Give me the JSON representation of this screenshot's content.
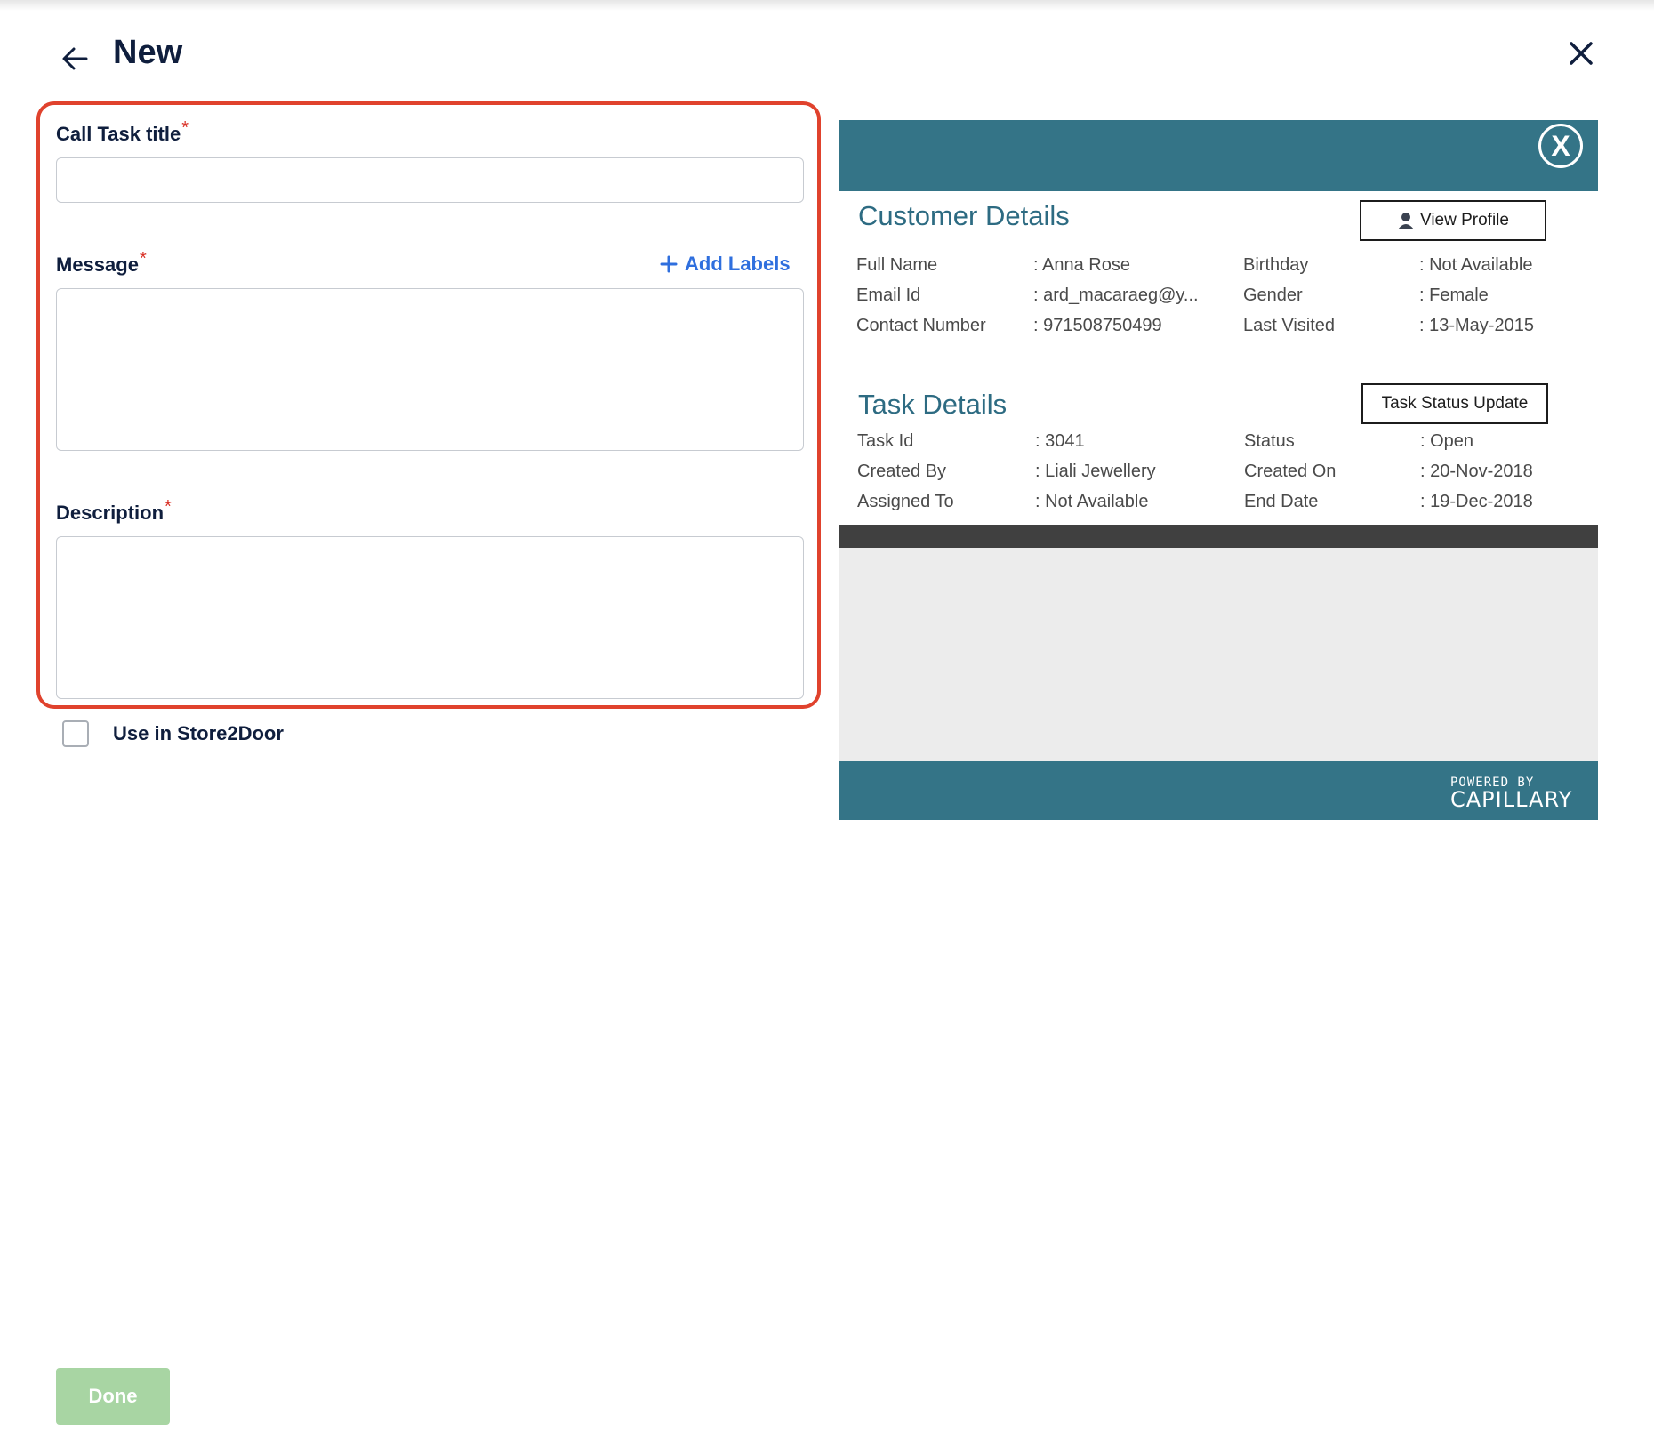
{
  "header": {
    "title": "New",
    "back_icon": "arrow-left-icon",
    "close_icon": "close-icon"
  },
  "form": {
    "title_label": "Call Task title",
    "title_value": "",
    "message_label": "Message",
    "message_value": "",
    "add_labels": "Add Labels",
    "description_label": "Description",
    "description_value": "",
    "required_mark": "*",
    "store2door_label": "Use in Store2Door",
    "store2door_checked": false,
    "done_label": "Done"
  },
  "preview": {
    "customer_title": "Customer Details",
    "view_profile": "View Profile",
    "customer_left": [
      {
        "key": "Full Name",
        "value": ": Anna Rose"
      },
      {
        "key": "Email Id",
        "value": ": ard_macaraeg@y..."
      },
      {
        "key": "Contact Number",
        "value": ": 971508750499"
      }
    ],
    "customer_right": [
      {
        "key": "Birthday",
        "value": ": Not Available"
      },
      {
        "key": "Gender",
        "value": ": Female"
      },
      {
        "key": "Last Visited",
        "value": ": 13-May-2015"
      }
    ],
    "task_title": "Task Details",
    "task_status_update": "Task Status Update",
    "task_left": [
      {
        "key": "Task Id",
        "value": ": 3041"
      },
      {
        "key": "Created By",
        "value": ": Liali Jewellery"
      },
      {
        "key": "Assigned To",
        "value": ": Not Available"
      }
    ],
    "task_right": [
      {
        "key": "Status",
        "value": ": Open"
      },
      {
        "key": "Created On",
        "value": ": 20-Nov-2018"
      },
      {
        "key": "End Date",
        "value": ": 19-Dec-2018"
      }
    ],
    "close_glyph": "X",
    "powered_by": "POWERED BY",
    "brand": "CAPILLARY"
  },
  "colors": {
    "highlight": "#e0422d",
    "accent_blue": "#2f6fde",
    "teal": "#347487",
    "done_disabled": "#a8d5a3",
    "title_navy": "#0f1e3d"
  }
}
